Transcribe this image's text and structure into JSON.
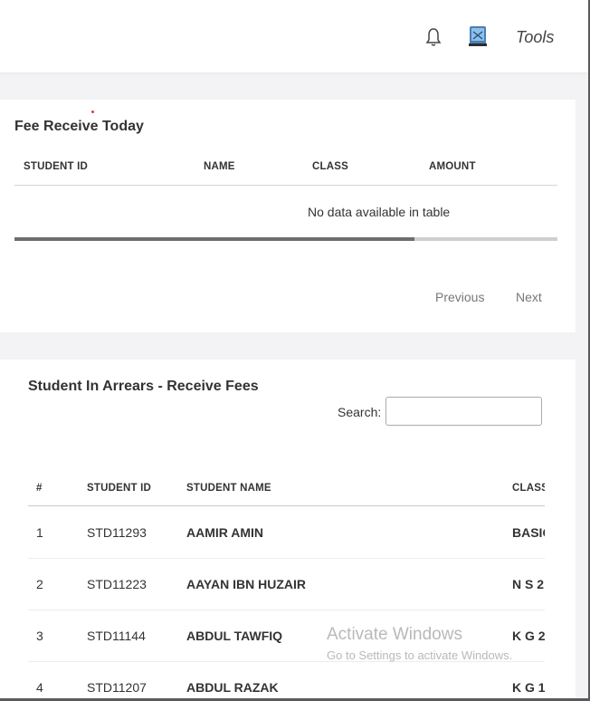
{
  "header": {
    "tools_label": "Tools",
    "bell_icon": "bell-icon",
    "avatar_icon": "school-logo-avatar"
  },
  "fee_today": {
    "title": "Fee Receive Today",
    "columns": [
      "STUDENT ID",
      "NAME",
      "CLASS",
      "AMOUNT"
    ],
    "empty_message": "No data available in table",
    "previous_label": "Previous",
    "next_label": "Next"
  },
  "arrears": {
    "title": "Student In Arrears - Receive Fees",
    "search_label": "Search:",
    "search_value": "",
    "columns": [
      "#",
      "STUDENT ID",
      "STUDENT NAME",
      "CLASS"
    ],
    "rows": [
      {
        "num": "1",
        "id": "STD11293",
        "name": "AAMIR AMIN",
        "class": "BASIC"
      },
      {
        "num": "2",
        "id": "STD11223",
        "name": "AAYAN IBN HUZAIR",
        "class": "N S 2"
      },
      {
        "num": "3",
        "id": "STD11144",
        "name": "ABDUL TAWFIQ",
        "class": "K G 2"
      },
      {
        "num": "4",
        "id": "STD11207",
        "name": "ABDUL RAZAK",
        "class": "K G 1"
      }
    ]
  },
  "watermark": {
    "line1": "Activate Windows",
    "line2": "Go to Settings to activate Windows."
  }
}
